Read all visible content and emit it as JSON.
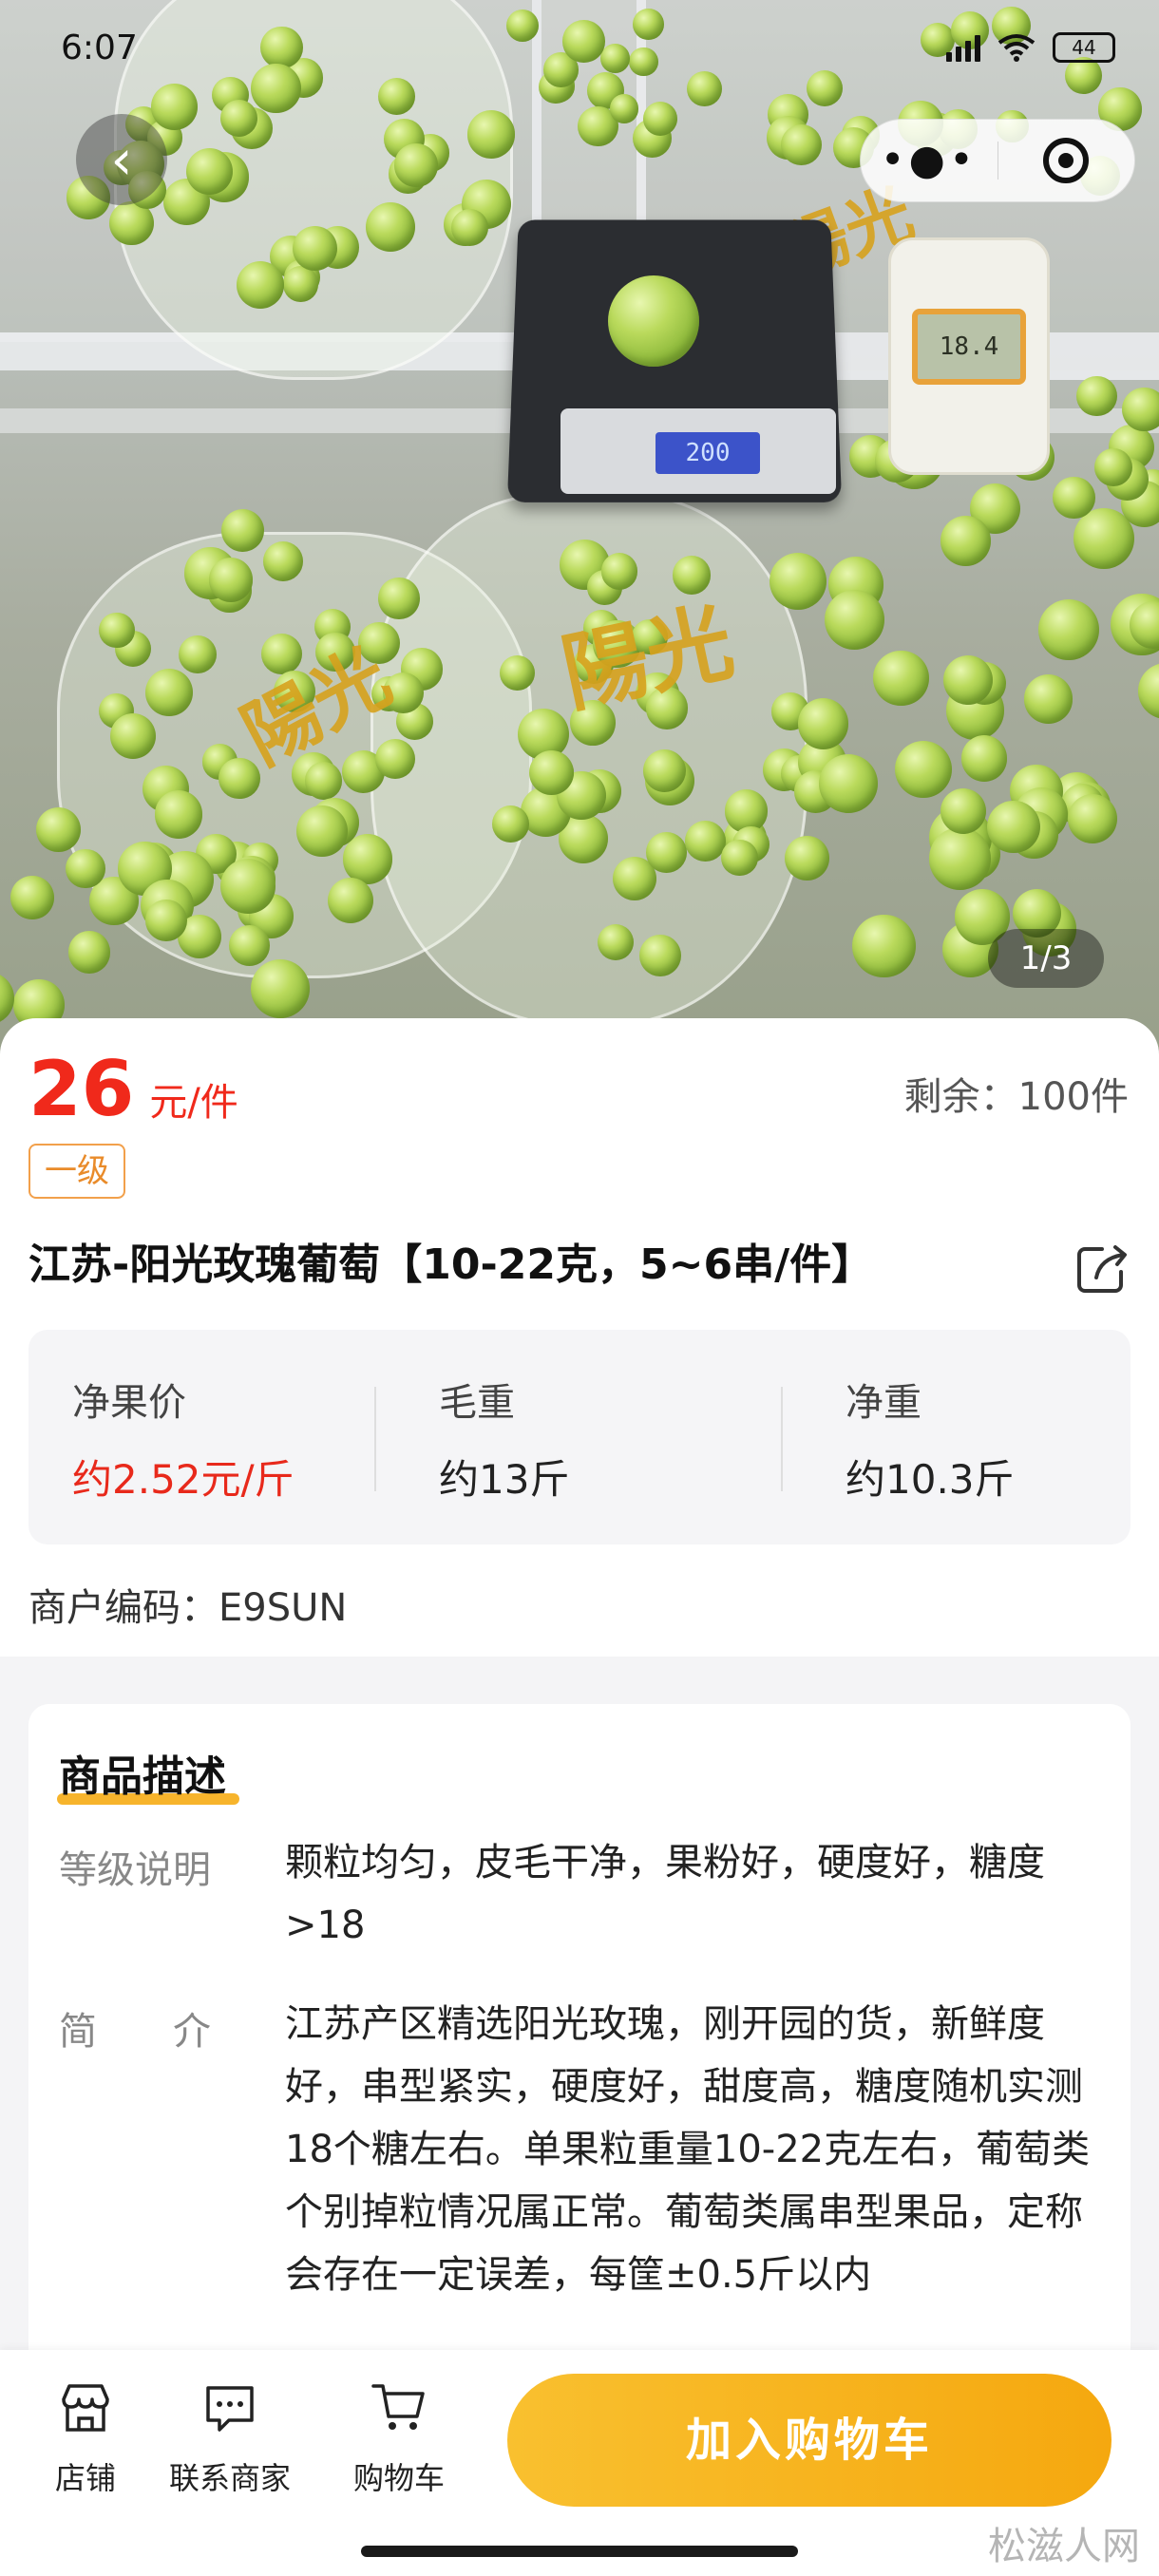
{
  "status_bar": {
    "time": "6:07",
    "battery": "44"
  },
  "gallery": {
    "page_indicator": "1/3",
    "scale_reading": "200",
    "meter_reading": "18.4",
    "bag_text": "陽光"
  },
  "product": {
    "price_number": "26",
    "price_unit": "元/件",
    "stock_text": "剩余：100件",
    "grade_tag": "一级",
    "title": "江苏-阳光玫瑰葡萄【10-22克，5~6串/件】",
    "stats": [
      {
        "label": "净果价",
        "value": "约2.52元/斤",
        "highlight": "#e8291b"
      },
      {
        "label": "毛重",
        "value": "约13斤"
      },
      {
        "label": "净重",
        "value": "约10.3斤"
      }
    ],
    "merchant_code": "商户编码：E9SUN"
  },
  "description": {
    "heading": "商品描述",
    "rows": [
      {
        "label": "等级说明",
        "text": "颗粒均匀，皮毛干净，果粉好，硬度好，糖度>18"
      },
      {
        "label": "简　　介",
        "text": "江苏产区精选阳光玫瑰，刚开园的货，新鲜度好，串型紧实，硬度好，甜度高，糖度随机实测18个糖左右。单果粒重量10-22克左右，葡萄类个别掉粒情况属正常。葡萄类属串型果品，定称会存在一定误差，每筐±0.5斤以内"
      }
    ]
  },
  "bottom_bar": {
    "nav": [
      {
        "label": "店铺",
        "icon": "store-icon"
      },
      {
        "label": "联系商家",
        "icon": "chat-icon"
      },
      {
        "label": "购物车",
        "icon": "cart-icon"
      }
    ],
    "cart_button": "加入购物车",
    "accent": "#f5a80f"
  },
  "watermark": "松滋人网"
}
